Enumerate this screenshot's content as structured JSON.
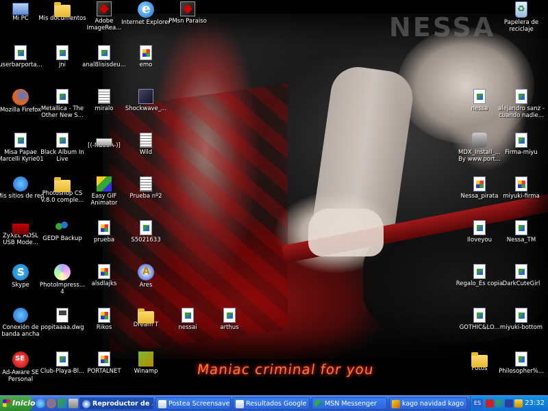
{
  "wallpaper": {
    "title": "NESSA",
    "caption": "Maniac criminal for you"
  },
  "desktop_icons": [
    {
      "label": "Mi PC",
      "icon": "my-computer-icon"
    },
    {
      "label": "Mis documentos",
      "icon": "folder-icon"
    },
    {
      "label": "Adobe ImageRea...",
      "icon": "app-icon"
    },
    {
      "label": "Internet Explorer",
      "icon": "internet-explorer-icon"
    },
    {
      "label": "PMsn Paraiso",
      "icon": "app-icon"
    },
    {
      "label": "Papelera de reciclaje",
      "icon": "recycle-bin-icon"
    },
    {
      "label": "userbarporta...",
      "icon": "image-file-icon"
    },
    {
      "label": "jni",
      "icon": "image-file-icon"
    },
    {
      "label": "anal8lisisdeu...",
      "icon": "image-file-icon"
    },
    {
      "label": "emo",
      "icon": "gif-file-icon"
    },
    {
      "label": "Mozilla Firefox",
      "icon": "firefox-icon"
    },
    {
      "label": "Metallica - The Other New S...",
      "icon": "image-file-icon"
    },
    {
      "label": "miralo",
      "icon": "text-file-icon"
    },
    {
      "label": "Shockwave_...",
      "icon": "shockwave-icon"
    },
    {
      "label": "nessa",
      "icon": "image-file-icon"
    },
    {
      "label": "alejandro sanz - cuando nadie...",
      "icon": "image-file-icon"
    },
    {
      "label": "Misa Papae Marcelli Kyrie01",
      "icon": "image-file-icon"
    },
    {
      "label": "Black Album In Live",
      "icon": "image-file-icon"
    },
    {
      "label": "[(-NESSA-)]",
      "icon": "drive-icon"
    },
    {
      "label": "Wild",
      "icon": "text-file-icon"
    },
    {
      "label": "MDX_Install_... By www.port...",
      "icon": "installer-icon"
    },
    {
      "label": "Firma-miyu",
      "icon": "image-file-icon"
    },
    {
      "label": "Mis sitios de red",
      "icon": "network-icon"
    },
    {
      "label": "Photoshop CS V.8.0 comple...",
      "icon": "folder-icon"
    },
    {
      "label": "Easy GIF Animator",
      "icon": "gif-animator-icon"
    },
    {
      "label": "Prueba nº2",
      "icon": "text-file-icon"
    },
    {
      "label": "Nessa_pirata",
      "icon": "gif-file-icon"
    },
    {
      "label": "miyuki-firma",
      "icon": "gif-file-icon"
    },
    {
      "label": "ZyXEL ADSL USB Mode...",
      "icon": "zyxel-icon"
    },
    {
      "label": "GEDP Backup",
      "icon": "msn-icon"
    },
    {
      "label": "prueba",
      "icon": "gif-file-icon"
    },
    {
      "label": "S5021633",
      "icon": "image-file-icon"
    },
    {
      "label": "Iloveyou",
      "icon": "image-file-icon"
    },
    {
      "label": "Nessa_TM",
      "icon": "image-file-icon"
    },
    {
      "label": "Skype",
      "icon": "skype-icon"
    },
    {
      "label": "PhotoImpress... 4",
      "icon": "cd-icon"
    },
    {
      "label": "alsdlajks",
      "icon": "gif-file-icon"
    },
    {
      "label": "Ares",
      "icon": "ares-icon"
    },
    {
      "label": "Regalo_Es copia",
      "icon": "image-file-icon"
    },
    {
      "label": "DarkCuteGirl",
      "icon": "image-file-icon"
    },
    {
      "label": "Conexión de banda ancha",
      "icon": "network-icon"
    },
    {
      "label": "popitaaaa.dwg",
      "icon": "dwg-file-icon"
    },
    {
      "label": "Rikos",
      "icon": "gif-file-icon"
    },
    {
      "label": "Dream T",
      "icon": "folder-icon"
    },
    {
      "label": "nessai",
      "icon": "image-file-icon"
    },
    {
      "label": "arthus",
      "icon": "image-file-icon"
    },
    {
      "label": "GOTHIC&LO...",
      "icon": "image-file-icon"
    },
    {
      "label": "miyuki-bottom",
      "icon": "image-file-icon"
    },
    {
      "label": "Ad-Aware SE Personal",
      "icon": "adaware-icon"
    },
    {
      "label": "Club-Playa-Bl...",
      "icon": "image-file-icon"
    },
    {
      "label": "PORTALNET",
      "icon": "gif-file-icon"
    },
    {
      "label": "Winamp",
      "icon": "winamp-icon"
    },
    {
      "label": "Fotos",
      "icon": "folder-icon"
    },
    {
      "label": "Philosopher%...",
      "icon": "image-file-icon"
    }
  ],
  "taskbar": {
    "start_label": "Inicio",
    "tasks": [
      {
        "label": "Reproductor de ...",
        "active": true
      },
      {
        "label": "Postea Screensaver ...",
        "active": false
      },
      {
        "label": "Resultados Google pa...",
        "active": false
      },
      {
        "label": "MSN Messenger",
        "active": false
      },
      {
        "label": "kago navidad kago a...",
        "active": false
      }
    ],
    "language": "ES",
    "clock": "23:32"
  },
  "colors": {
    "taskbar": "#2a5fd0",
    "start_button": "#2a8a2a",
    "caption": "#f07a3a"
  }
}
